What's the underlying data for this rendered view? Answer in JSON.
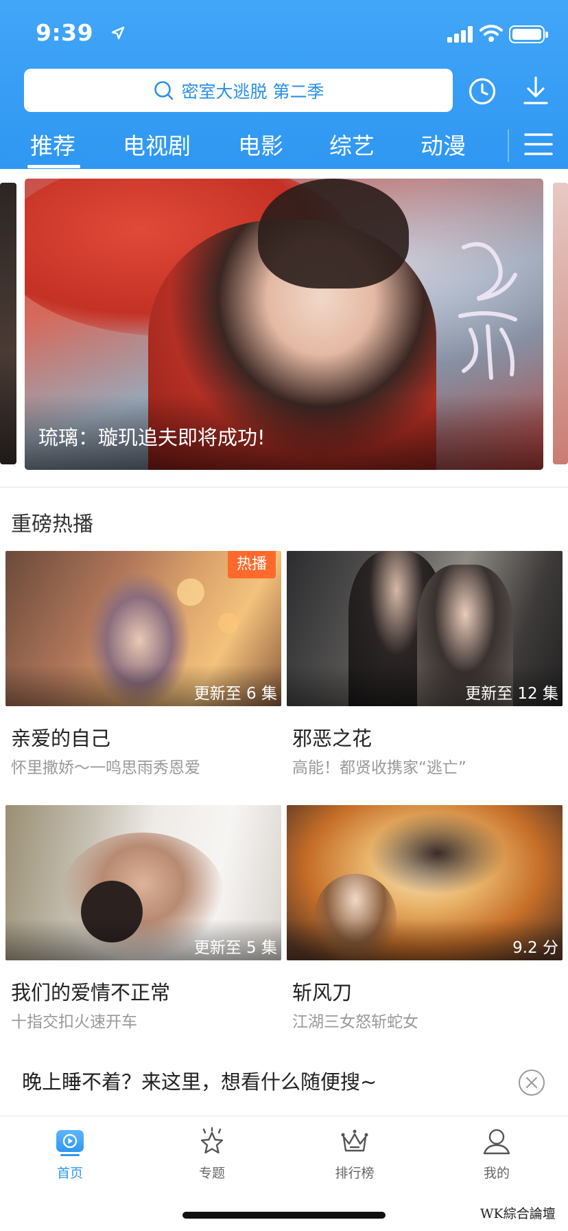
{
  "status_bar": {
    "time": "9:39"
  },
  "header": {
    "search_placeholder": "密室大逃脱 第二季",
    "tabs": [
      {
        "label": "推荐",
        "active": true
      },
      {
        "label": "电视剧"
      },
      {
        "label": "电影"
      },
      {
        "label": "综艺"
      },
      {
        "label": "动漫"
      }
    ]
  },
  "banner": {
    "caption": "琉璃：璇玑追夫即将成功!"
  },
  "section": {
    "title": "重磅热播"
  },
  "cards": [
    {
      "title": "亲爱的自己",
      "subtitle": "怀里撒娇～一鸣思雨秀恩爱",
      "badge": "更新至 6 集",
      "tag": "热播"
    },
    {
      "title": "邪恶之花",
      "subtitle": "高能！都贤收携家“逃亡”",
      "badge": "更新至 12 集"
    },
    {
      "title": "我们的爱情不正常",
      "subtitle": "十指交扣火速开车",
      "badge": "更新至 5 集"
    },
    {
      "title": "斩风刀",
      "subtitle": "江湖三女怒斩蛇女",
      "badge": "9.2 分"
    }
  ],
  "promo": {
    "text": "晚上睡不着？来这里，想看什么随便搜~"
  },
  "tabbar": {
    "items": [
      {
        "label": "首页",
        "icon": "home-play-icon",
        "active": true
      },
      {
        "label": "专题",
        "icon": "star-icon"
      },
      {
        "label": "排行榜",
        "icon": "crown-icon"
      },
      {
        "label": "我的",
        "icon": "user-icon"
      }
    ]
  },
  "watermark": "WK綜合論壇",
  "colors": {
    "accent": "#2f97f2",
    "hot_tag": "#ff6a2c"
  }
}
